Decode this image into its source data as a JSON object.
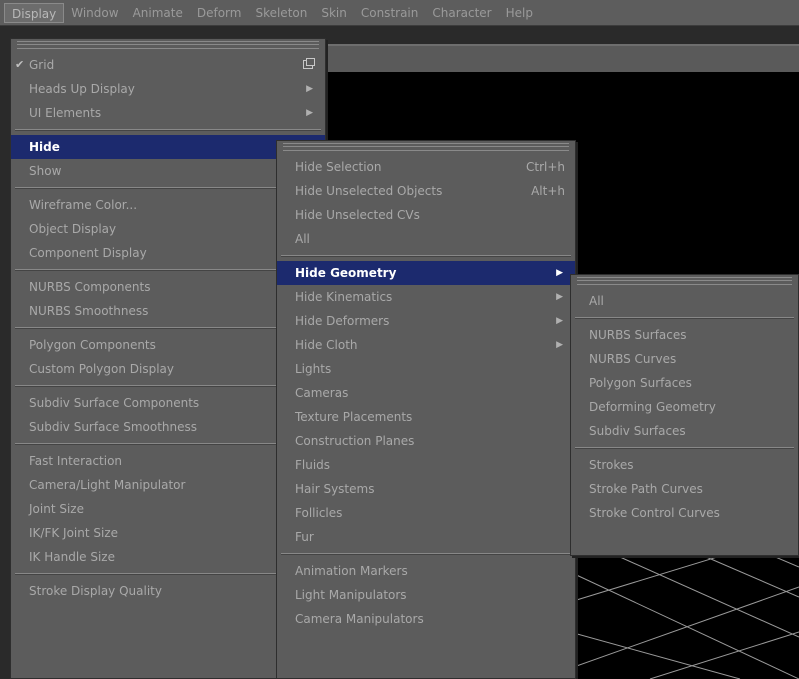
{
  "menubar": [
    "Display",
    "Window",
    "Animate",
    "Deform",
    "Skeleton",
    "Skin",
    "Constrain",
    "Character",
    "Help"
  ],
  "display_menu": {
    "items": [
      {
        "label": "Grid",
        "check": "✔",
        "option": true
      },
      {
        "label": "Heads Up Display",
        "submenu": true
      },
      {
        "label": "UI Elements",
        "submenu": true
      },
      {
        "sep": true
      },
      {
        "label": "Hide",
        "submenu": true,
        "highlight": true
      },
      {
        "label": "Show",
        "submenu": true
      },
      {
        "sep": true
      },
      {
        "label": "Wireframe Color..."
      },
      {
        "label": "Object Display",
        "submenu": true
      },
      {
        "label": "Component Display",
        "submenu": true
      },
      {
        "sep": true
      },
      {
        "label": "NURBS Components",
        "submenu": true
      },
      {
        "label": "NURBS Smoothness",
        "submenu": true
      },
      {
        "sep": true
      },
      {
        "label": "Polygon Components",
        "submenu": true
      },
      {
        "label": "Custom Polygon Display"
      },
      {
        "sep": true
      },
      {
        "label": "Subdiv Surface Components",
        "submenu": true
      },
      {
        "label": "Subdiv Surface Smoothness",
        "submenu": true
      },
      {
        "sep": true
      },
      {
        "label": "Fast Interaction"
      },
      {
        "label": "Camera/Light Manipulator",
        "submenu": true
      },
      {
        "label": "Joint Size",
        "submenu": true
      },
      {
        "label": "IK/FK Joint Size",
        "submenu": true
      },
      {
        "label": "IK Handle Size",
        "submenu": true
      },
      {
        "sep": true
      },
      {
        "label": "Stroke Display Quality",
        "submenu": true
      }
    ]
  },
  "hide_menu": {
    "items": [
      {
        "label": "Hide Selection",
        "shortcut": "Ctrl+h"
      },
      {
        "label": "Hide Unselected Objects",
        "shortcut": "Alt+h"
      },
      {
        "label": "Hide Unselected CVs"
      },
      {
        "label": "All"
      },
      {
        "sep": true
      },
      {
        "label": "Hide Geometry",
        "submenu": true,
        "highlight": true
      },
      {
        "label": "Hide Kinematics",
        "submenu": true
      },
      {
        "label": "Hide Deformers",
        "submenu": true
      },
      {
        "label": "Hide Cloth",
        "submenu": true
      },
      {
        "label": "Lights"
      },
      {
        "label": "Cameras"
      },
      {
        "label": "Texture Placements"
      },
      {
        "label": "Construction Planes"
      },
      {
        "label": "Fluids"
      },
      {
        "label": "Hair Systems"
      },
      {
        "label": "Follicles"
      },
      {
        "label": "Fur"
      },
      {
        "sep": true
      },
      {
        "label": "Animation Markers"
      },
      {
        "label": "Light Manipulators"
      },
      {
        "label": "Camera Manipulators"
      }
    ]
  },
  "geometry_menu": {
    "items": [
      {
        "label": "All"
      },
      {
        "sep": true
      },
      {
        "label": "NURBS Surfaces"
      },
      {
        "label": "NURBS Curves"
      },
      {
        "label": "Polygon Surfaces"
      },
      {
        "label": "Deforming Geometry"
      },
      {
        "label": "Subdiv Surfaces"
      },
      {
        "sep": true
      },
      {
        "label": "Strokes"
      },
      {
        "label": "Stroke Path Curves"
      },
      {
        "label": "Stroke Control Curves"
      }
    ]
  }
}
